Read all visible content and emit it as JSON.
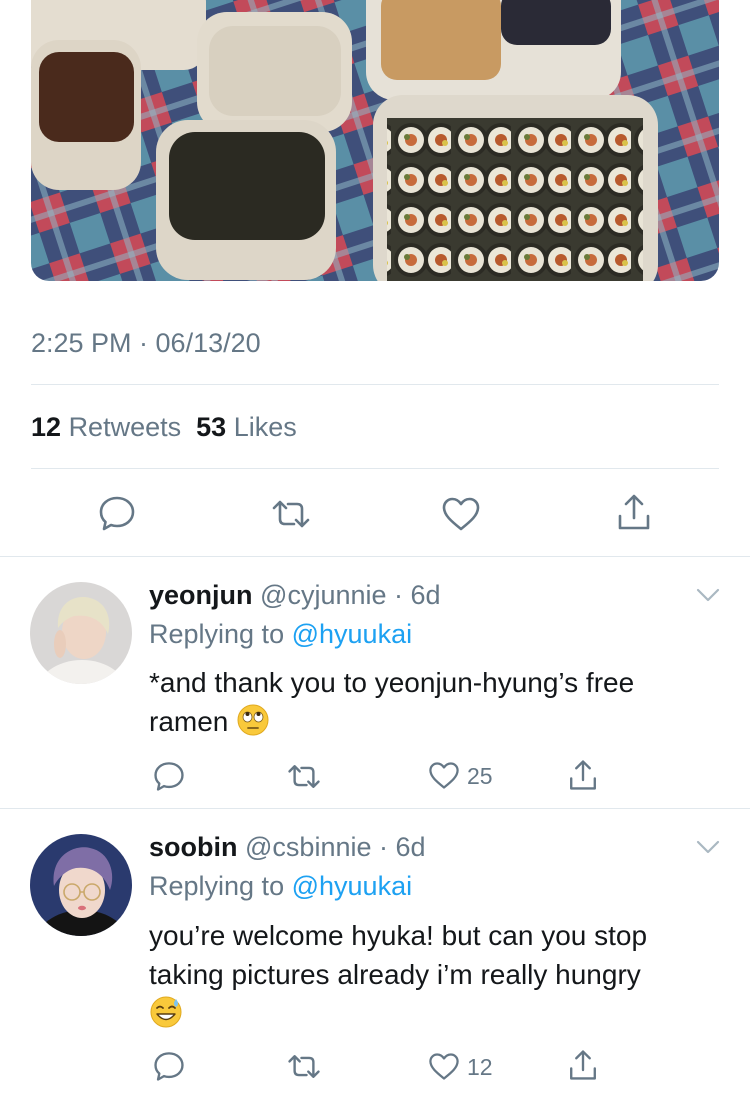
{
  "tweet": {
    "timestamp": "2:25 PM · 06/13/20",
    "retweets_count": "12",
    "retweets_label": "Retweets",
    "likes_count": "53",
    "likes_label": "Likes"
  },
  "replies": [
    {
      "name": "yeonjun",
      "handle": "@cyjunnie",
      "age": "· 6d",
      "replying_prefix": "Replying to",
      "replying_to": "@hyuukai",
      "text_line1": "*and thank you to yeonjun-hyung’s free",
      "text_line2": "ramen",
      "emoji": "face-with-rolling-eyes-emoji",
      "likes": "25"
    },
    {
      "name": "soobin",
      "handle": "@csbinnie",
      "age": "· 6d",
      "replying_prefix": "Replying to",
      "replying_to": "@hyuukai",
      "text_line1": "you’re welcome hyuka! but can you stop",
      "text_line2": "taking pictures already i’m really hungry",
      "emoji": "grinning-face-with-sweat-emoji",
      "likes": "12"
    }
  ],
  "colors": {
    "text_primary": "#14171a",
    "text_secondary": "#657786",
    "link": "#1da1f2",
    "divider": "#e1e8ed"
  }
}
